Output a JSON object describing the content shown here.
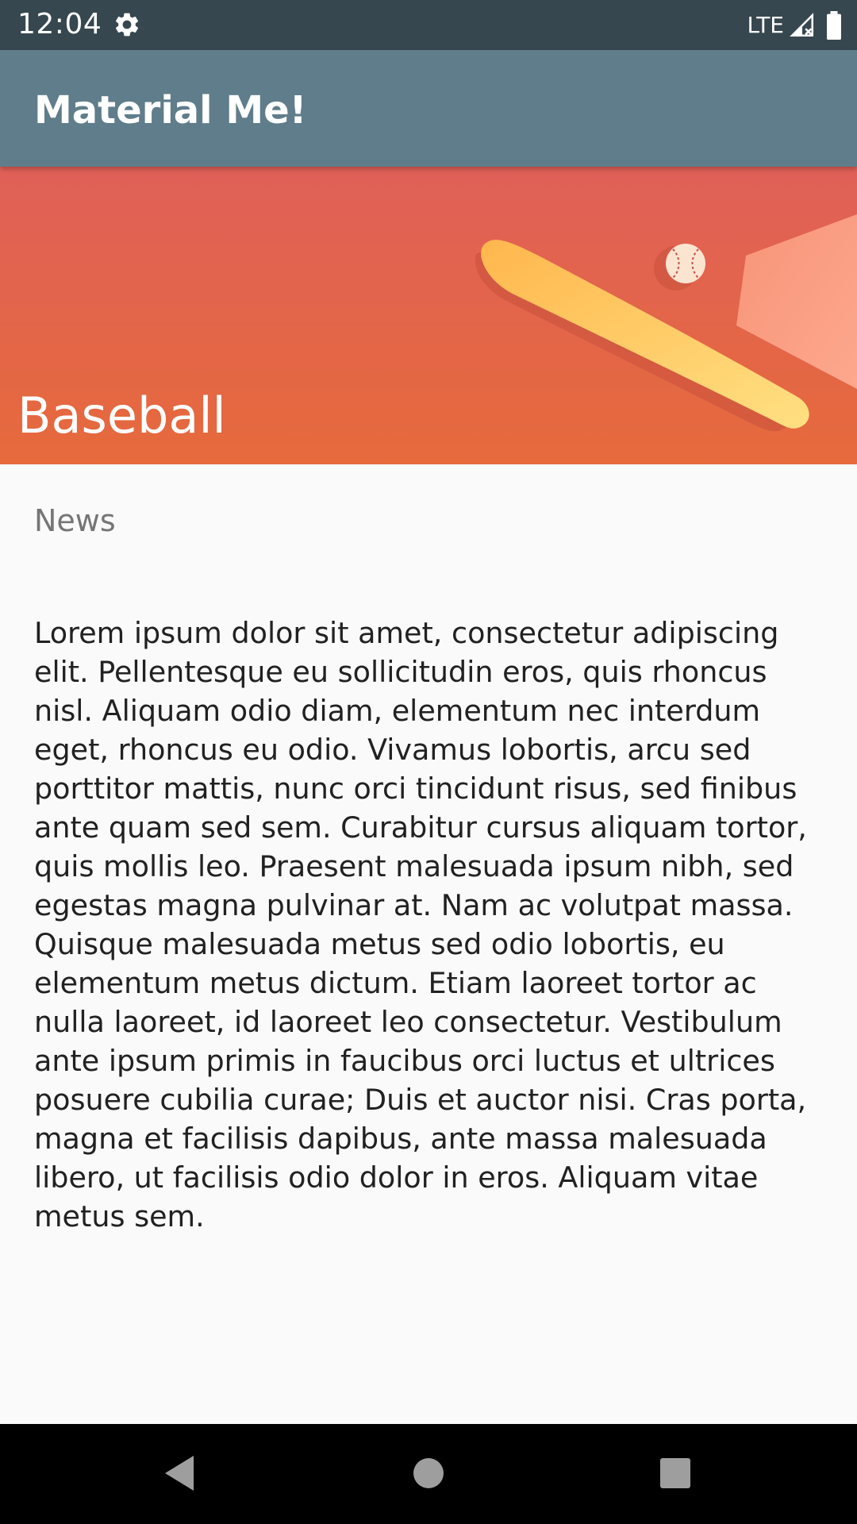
{
  "status_bar": {
    "time": "12:04",
    "network": "LTE",
    "icons": [
      "settings-icon",
      "signal-icon",
      "battery-icon"
    ]
  },
  "app_bar": {
    "title": "Material Me!",
    "background_color": "#607d8b"
  },
  "hero": {
    "title": "Baseball",
    "image": "baseball-bat-ball-illustration"
  },
  "content": {
    "subtitle": "News",
    "body": "Lorem ipsum dolor sit amet, consectetur adipiscing elit. Pellentesque eu sollicitudin eros, quis rhoncus nisl. Aliquam odio diam, elementum nec interdum eget, rhoncus eu odio. Vivamus lobortis, arcu sed porttitor mattis, nunc orci tincidunt risus, sed finibus ante quam sed sem. Curabitur cursus aliquam tortor, quis mollis leo. Praesent malesuada ipsum nibh, sed egestas magna pulvinar at. Nam ac volutpat massa. Quisque malesuada metus sed odio lobortis, eu elementum metus dictum. Etiam laoreet tortor ac nulla laoreet, id laoreet leo consectetur. Vestibulum ante ipsum primis in faucibus orci luctus et ultrices posuere cubilia curae; Duis et auctor nisi. Cras porta, magna et facilisis dapibus, ante massa malesuada libero, ut facilisis odio dolor in eros. Aliquam vitae metus sem."
  },
  "nav_bar": {
    "buttons": [
      "back-icon",
      "home-icon",
      "recents-icon"
    ]
  }
}
